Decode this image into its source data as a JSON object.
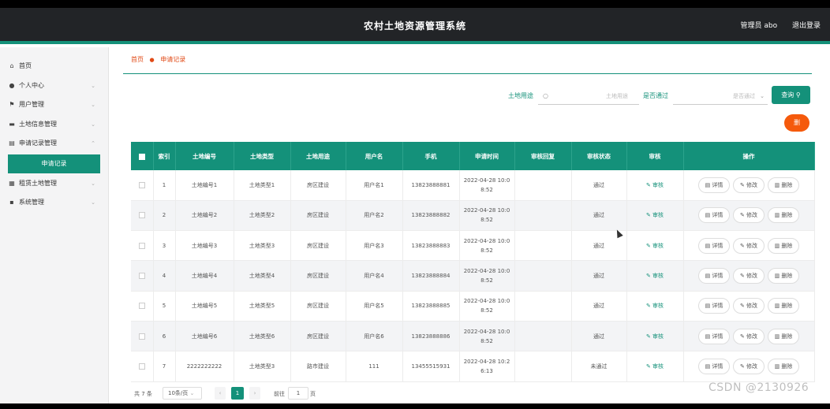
{
  "header": {
    "title": "农村土地资源管理系统",
    "user_label": "管理员 abo",
    "logout": "退出登录"
  },
  "sidebar": {
    "items": [
      {
        "label": "首页",
        "icon": "home-icon"
      },
      {
        "label": "个人中心",
        "icon": "user-icon"
      },
      {
        "label": "用户管理",
        "icon": "flag-icon"
      },
      {
        "label": "土地信息管理",
        "icon": "folder-icon"
      },
      {
        "label": "申请记录管理",
        "icon": "doc-icon"
      },
      {
        "label": "申请记录",
        "sub": true
      },
      {
        "label": "租赁土地管理",
        "icon": "grid-icon"
      },
      {
        "label": "系统管理",
        "icon": "gear-icon"
      }
    ]
  },
  "breadcrumb": {
    "home": "首页",
    "current": "申请记录"
  },
  "search": {
    "land_use_label": "土地用途",
    "land_use_placeholder": "土地用途",
    "passed_label": "是否通过",
    "passed_placeholder": "是否通过",
    "search_button": "查询",
    "delete_button": "删"
  },
  "table": {
    "headers": [
      "索引",
      "土地编号",
      "土地类型",
      "土地用途",
      "用户名",
      "手机",
      "申请时间",
      "审核回复",
      "审核状态",
      "审核",
      "操作"
    ],
    "review_label": "审核",
    "actions": [
      "详情",
      "修改",
      "删除"
    ],
    "rows": [
      {
        "idx": "1",
        "no": "土地编号1",
        "type": "土地类型1",
        "use": "房区建设",
        "user": "用户名1",
        "phone": "13823888881",
        "time1": "2022-04-28 10:0",
        "time2": "8:52",
        "reply": "",
        "status": "通过"
      },
      {
        "idx": "2",
        "no": "土地编号2",
        "type": "土地类型2",
        "use": "房区建设",
        "user": "用户名2",
        "phone": "13823888882",
        "time1": "2022-04-28 10:0",
        "time2": "8:52",
        "reply": "",
        "status": "通过"
      },
      {
        "idx": "3",
        "no": "土地编号3",
        "type": "土地类型3",
        "use": "房区建设",
        "user": "用户名3",
        "phone": "13823888883",
        "time1": "2022-04-28 10:0",
        "time2": "8:52",
        "reply": "",
        "status": "通过"
      },
      {
        "idx": "4",
        "no": "土地编号4",
        "type": "土地类型4",
        "use": "房区建设",
        "user": "用户名4",
        "phone": "13823888884",
        "time1": "2022-04-28 10:0",
        "time2": "8:52",
        "reply": "",
        "status": "通过"
      },
      {
        "idx": "5",
        "no": "土地编号5",
        "type": "土地类型5",
        "use": "房区建设",
        "user": "用户名5",
        "phone": "13823888885",
        "time1": "2022-04-28 10:0",
        "time2": "8:52",
        "reply": "",
        "status": "通过"
      },
      {
        "idx": "6",
        "no": "土地编号6",
        "type": "土地类型6",
        "use": "房区建设",
        "user": "用户名6",
        "phone": "13823888886",
        "time1": "2022-04-28 10:0",
        "time2": "8:52",
        "reply": "",
        "status": "通过"
      },
      {
        "idx": "7",
        "no": "2222222222",
        "type": "土地类型3",
        "use": "路市建设",
        "user": "111",
        "phone": "13455515931",
        "time1": "2022-04-28 10:2",
        "time2": "6:13",
        "reply": "",
        "status": "未通过"
      }
    ]
  },
  "pager": {
    "total": "共 7 条",
    "page_size": "10条/页",
    "current": "1",
    "goto_label": "前往",
    "goto_value": "1",
    "page_suffix": "页"
  },
  "watermark": "CSDN @2130926",
  "colors": {
    "accent": "#14917a",
    "danger": "#f55a0c",
    "header": "#222427"
  }
}
